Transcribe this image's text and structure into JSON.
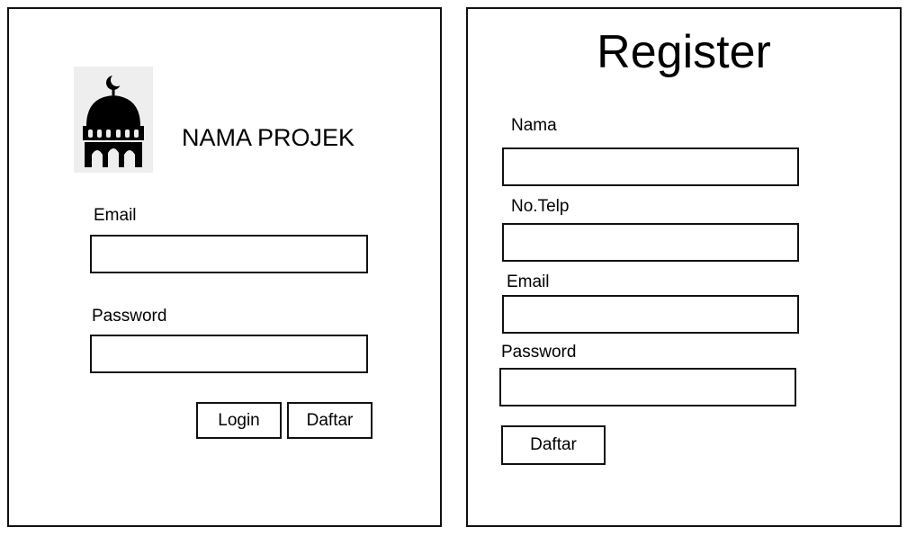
{
  "login": {
    "project_name": "NAMA PROJEK",
    "logo_icon": "mosque-icon",
    "email_label": "Email",
    "email_value": "",
    "password_label": "Password",
    "password_value": "",
    "login_button": "Login",
    "register_button": "Daftar"
  },
  "register": {
    "title": "Register",
    "name_label": "Nama",
    "name_value": "",
    "phone_label": "No.Telp",
    "phone_value": "",
    "email_label": "Email",
    "email_value": "",
    "password_label": "Password",
    "password_value": "",
    "submit_button": "Daftar"
  }
}
